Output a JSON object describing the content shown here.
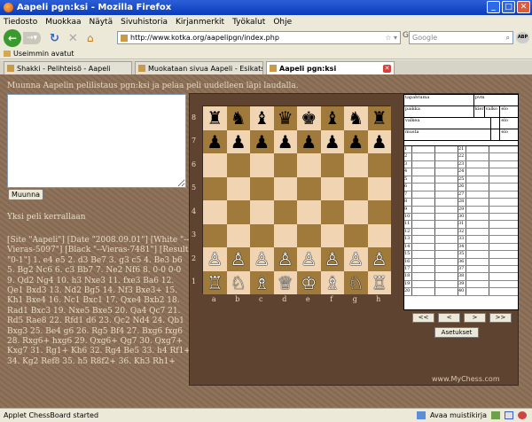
{
  "window": {
    "title": "Aapeli pgn:ksi - Mozilla Firefox"
  },
  "menu": [
    "Tiedosto",
    "Muokkaa",
    "Näytä",
    "Sivuhistoria",
    "Kirjanmerkit",
    "Työkalut",
    "Ohje"
  ],
  "nav": {
    "url": "http://www.kotka.org/aapelipgn/index.php",
    "search_placeholder": "Google"
  },
  "bookmarks": {
    "most_visited": "Useimmin avatut"
  },
  "tabs": [
    {
      "label": "Shakki - Pelihteisö - Aapeli"
    },
    {
      "label": "Muokataan sivua Aapeli - Esikatselu - S..."
    },
    {
      "label": "Aapeli pgn:ksi"
    }
  ],
  "page": {
    "intro": "Muunna Aapelin pelilistaus pgn:ksi ja pelaa peli uudelleen läpi laudalla.",
    "convert_button": "Muunna",
    "one_line": "Yksi peli kerrallaan",
    "pgn_text": "[Site \"Aapeli\"] [Date \"2008.09.01\"] [White \"--Vieras-5097\"] [Black \"--Vieras-7481\"] [Result \"0-1\"] 1. e4 e5 2. d3 Be7 3. g3 c5 4. Be3 b6 5. Bg2 Nc6 6. c3 Bb7 7. Ne2 Nf6 8. 0-0 0-0 9. Qd2 Ng4 10. h3 Nxe3 11. fxe3 Ba6 12. Qe1 Bxd3 13. Nd2 Bg5 14. Nf3 Bxe3+ 15. Kh1 Bxe4 16. Nc1 Bxc1 17. Qxe4 Bxb2 18. Rad1 Bxc3 19. Nxe5 Bxe5 20. Qa4 Qc7 21. Rd5 Rae8 22. Rfd1 d6 23. Qc2 Nd4 24. Qb1 Bxg3 25. Be4 g6 26. Rg5 Bf4 27. Bxg6 fxg6 28. Rxg6+ hxg6 29. Qxg6+ Qg7 30. Qxg7+ Kxg7 31. Rg1+ Kh6 32. Rg4 Be5 33. h4 Rf1+ 34. Kg2 Ref8 35. h5 R8f2+ 36. Kh3 Rh1+",
    "rank_labels": [
      "8",
      "7",
      "6",
      "5",
      "4",
      "3",
      "2",
      "1"
    ],
    "file_labels": [
      "a",
      "b",
      "c",
      "d",
      "e",
      "f",
      "g",
      "h"
    ],
    "board": [
      [
        "♜",
        "♞",
        "♝",
        "♛",
        "♚",
        "♝",
        "♞",
        "♜"
      ],
      [
        "♟",
        "♟",
        "♟",
        "♟",
        "♟",
        "♟",
        "♟",
        "♟"
      ],
      [
        "",
        "",
        "",
        "",
        "",
        "",
        "",
        ""
      ],
      [
        "",
        "",
        "",
        "",
        "",
        "",
        "",
        ""
      ],
      [
        "",
        "",
        "",
        "",
        "",
        "",
        "",
        ""
      ],
      [
        "",
        "",
        "",
        "",
        "",
        "",
        "",
        ""
      ],
      [
        "♙",
        "♙",
        "♙",
        "♙",
        "♙",
        "♙",
        "♙",
        "♙"
      ],
      [
        "♖",
        "♘",
        "♗",
        "♕",
        "♔",
        "♗",
        "♘",
        "♖"
      ]
    ],
    "scoresheet": {
      "header": [
        [
          "tapahtuma",
          "pvm"
        ],
        [
          "paikka",
          "kierr.",
          "valko",
          "elo"
        ],
        [
          "valkea",
          "",
          "elo"
        ],
        [
          "musta",
          "",
          "elo"
        ]
      ],
      "rows": [
        [
          "1",
          "21"
        ],
        [
          "2",
          "22"
        ],
        [
          "3",
          "23"
        ],
        [
          "4",
          "24"
        ],
        [
          "5",
          "25"
        ],
        [
          "6",
          "26"
        ],
        [
          "7",
          "27"
        ],
        [
          "8",
          "28"
        ],
        [
          "9",
          "29"
        ],
        [
          "10",
          "30"
        ],
        [
          "11",
          "31"
        ],
        [
          "12",
          "32"
        ],
        [
          "13",
          "33"
        ],
        [
          "14",
          "34"
        ],
        [
          "15",
          "35"
        ],
        [
          "16",
          "36"
        ],
        [
          "17",
          "37"
        ],
        [
          "18",
          "38"
        ],
        [
          "19",
          "39"
        ],
        [
          "20",
          "40"
        ]
      ]
    },
    "nav_buttons": [
      "<<",
      "<",
      ">",
      ">>"
    ],
    "settings_button": "Asetukset",
    "watermark": "www.MyChess.com"
  },
  "status": {
    "left": "Applet ChessBoard started",
    "notes": "Avaa muistikirja"
  }
}
